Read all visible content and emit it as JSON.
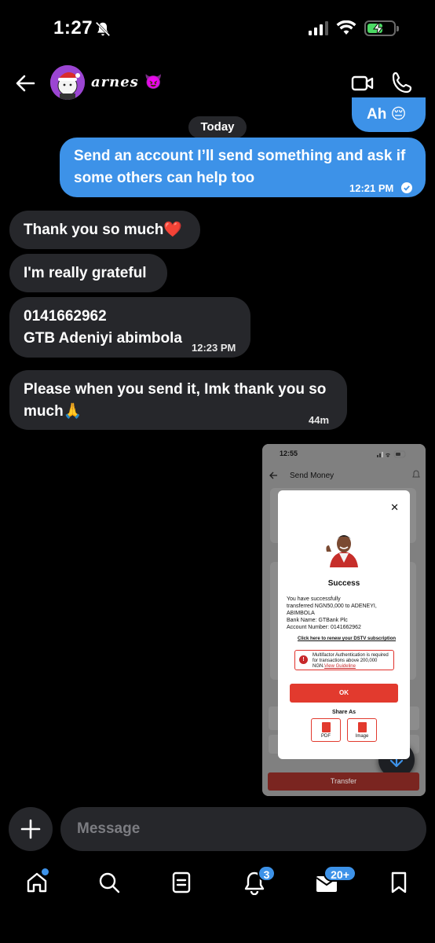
{
  "status_bar": {
    "time": "1:27"
  },
  "header": {
    "contact_name": "arnes",
    "contact_emoji": "😈"
  },
  "messages": {
    "prev_out": "Ah 😔",
    "date_divider": "Today",
    "out1": {
      "text": "Send an account I’ll send something and ask if some others can help too",
      "time": "12:21 PM"
    },
    "in1": "Thank you so much❤️",
    "in2": "I'm really grateful",
    "in3": {
      "line1": "0141662962",
      "line2": "GTB Adeniyi abimbola",
      "time": "12:23 PM"
    },
    "in4": {
      "text": "Please when you send it, Imk thank you so much🙏",
      "time": "44m"
    }
  },
  "screenshot": {
    "time": "12:55",
    "title": "Send Money",
    "success": "Success",
    "desc_lines": [
      "You have successfully",
      "transferred NGN50,000 to ADENEYI,",
      "ABIMBOLA",
      "Bank Name: GTBank Plc",
      "Account Number: 0141662962"
    ],
    "renew_link": "Click here to renew your DSTV subscription",
    "mfa_text": "Multifactor Authentication is required for transactions above 200,000 NGN.",
    "mfa_link": "View Guideline",
    "ok_label": "OK",
    "share_label": "Share As",
    "pdf_label": "PDF",
    "image_label": "Image",
    "transfer_label": "Transfer"
  },
  "composer": {
    "placeholder": "Message"
  },
  "tabbar": {
    "notifications_badge": "3",
    "messages_badge": "20+"
  },
  "colors": {
    "accent": "#3d92e8",
    "bubble_in": "#26272b",
    "background": "#000000"
  }
}
